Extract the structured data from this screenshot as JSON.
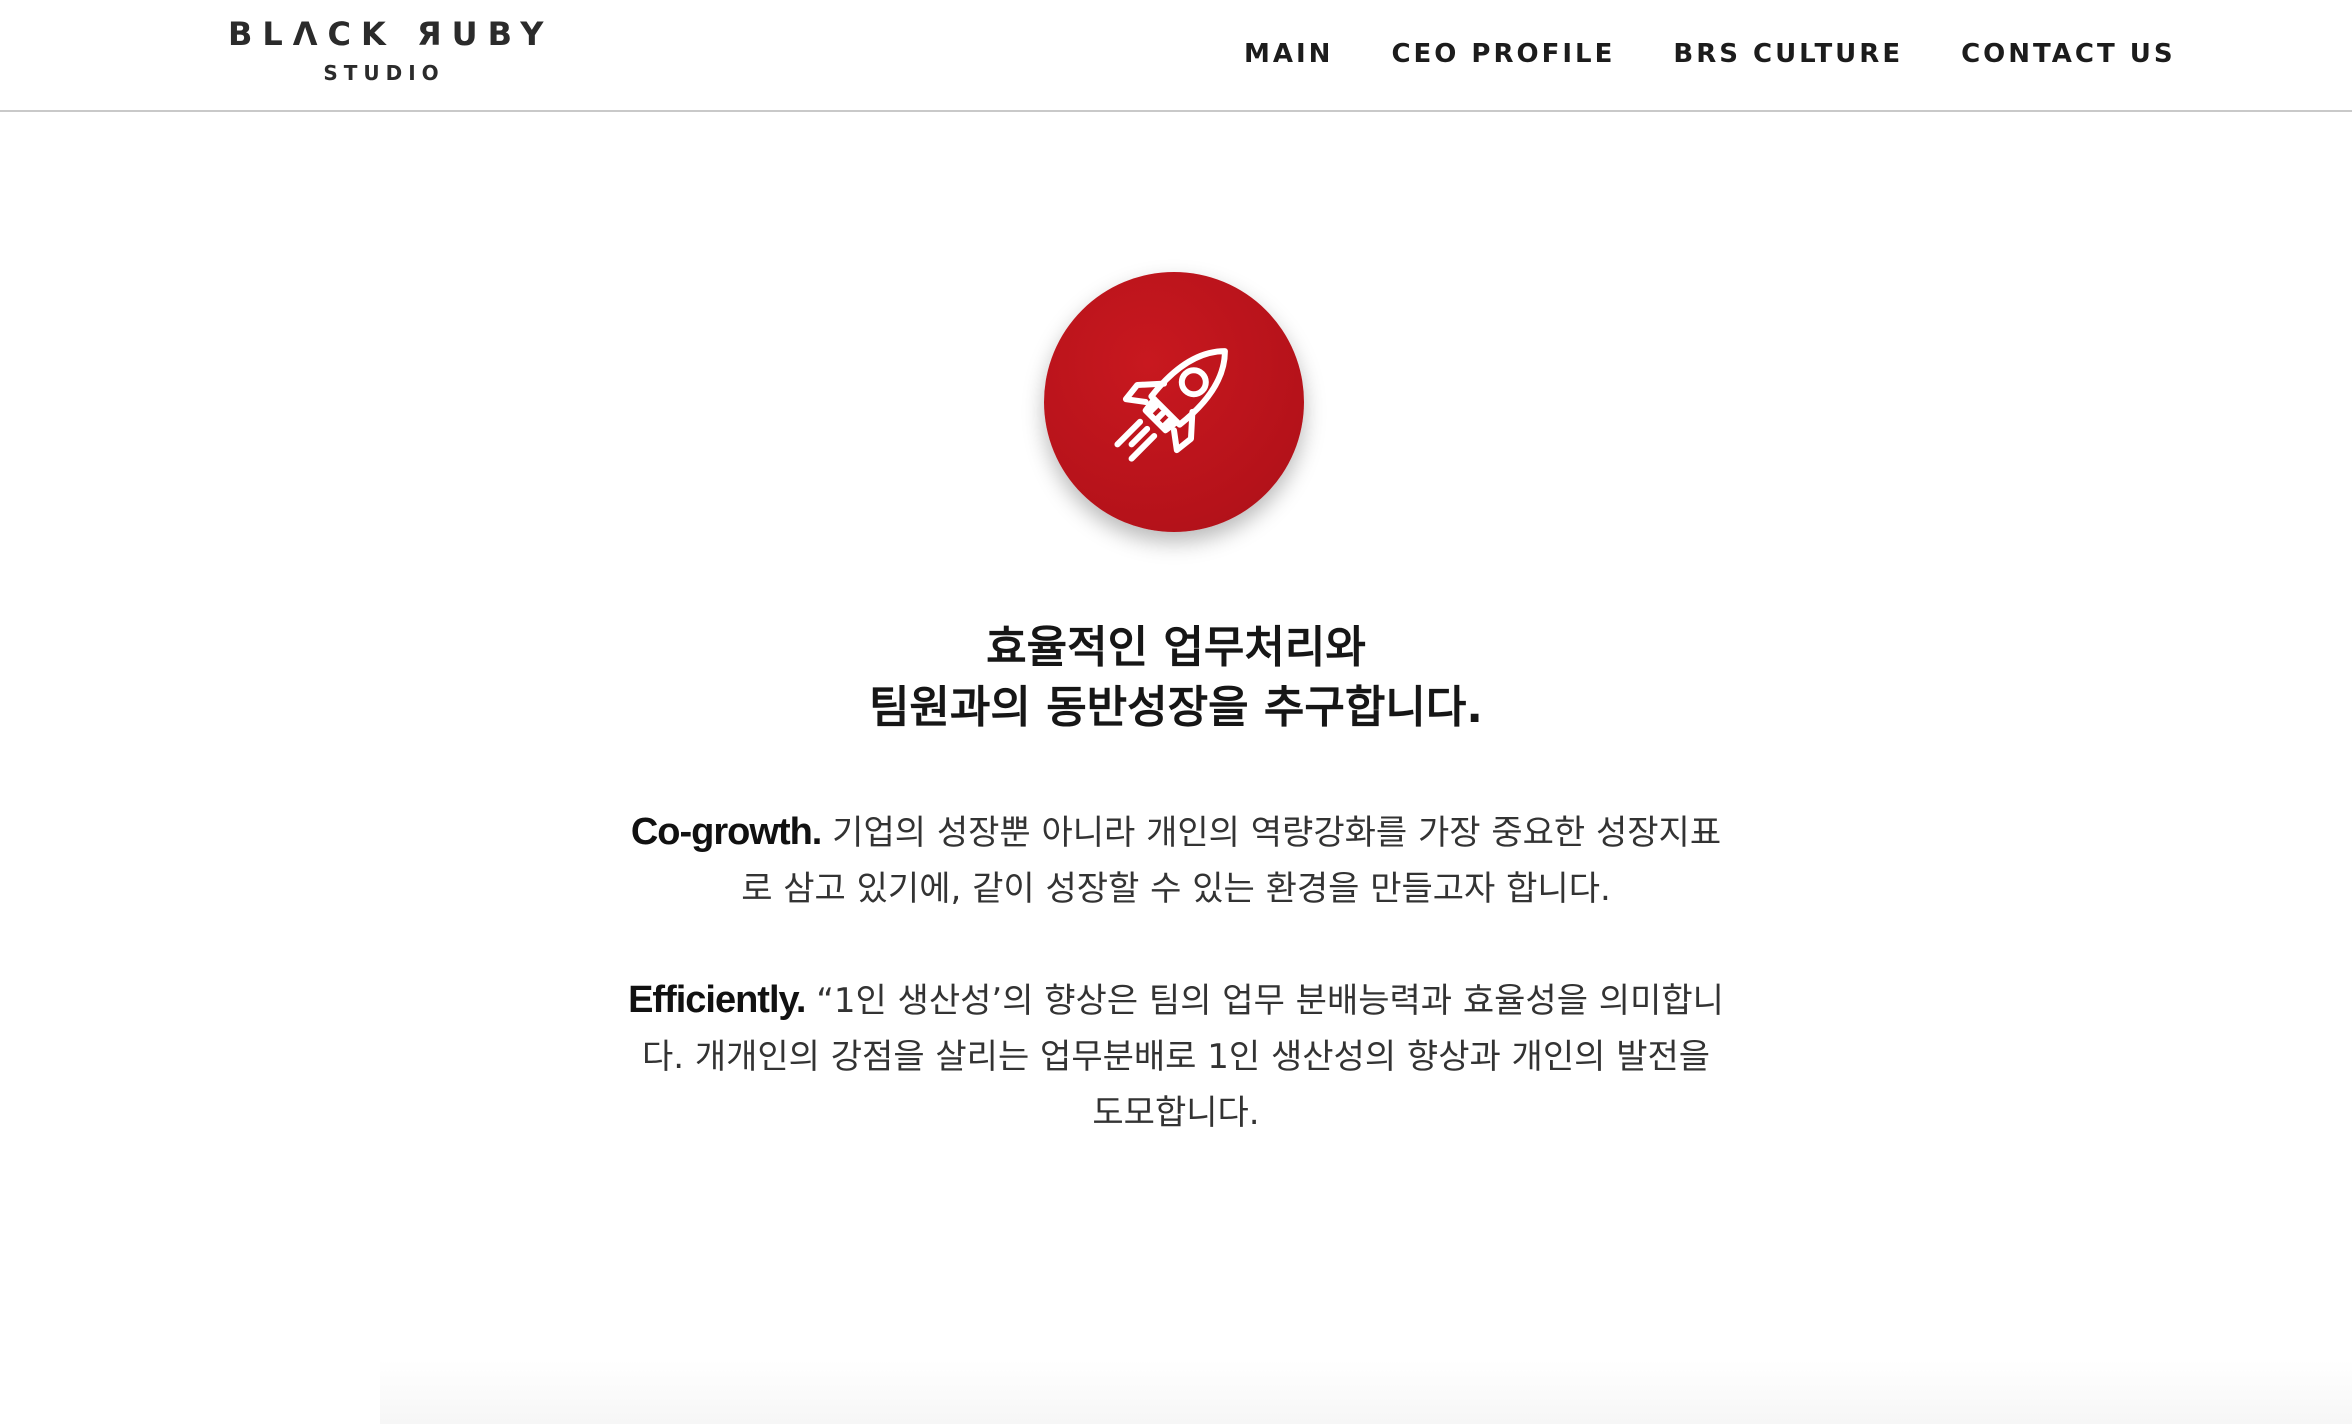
{
  "logo": {
    "line1": "BLΛCK ЯUBY",
    "line2": "STUDIO"
  },
  "nav": {
    "items": [
      {
        "label": "MAIN"
      },
      {
        "label": "CEO PROFILE"
      },
      {
        "label": "BRS CULTURE"
      },
      {
        "label": "CONTACT US"
      }
    ]
  },
  "hero": {
    "icon": "rocket-icon",
    "icon_bg_color": "#b5121a",
    "headline_line1": "효율적인 업무처리와",
    "headline_line2": "팀원과의 동반성장을 추구합니다.",
    "cogrowth_title": "Co-growth.",
    "cogrowth_text": " 기업의 성장뿐 아니라 개인의 역량강화를 가장 중요한 성장지표로 삼고 있기에, 같이 성장할 수 있는 환경을 만들고자 합니다.",
    "efficiently_title": "Efficiently.",
    "efficiently_text": " “1인 생산성’의 향상은 팀의 업무 분배능력과 효율성을 의미합니다. 개개인의 강점을 살리는 업무분배로 1인 생산성의 향상과 개인의 발전을 도모합니다."
  }
}
